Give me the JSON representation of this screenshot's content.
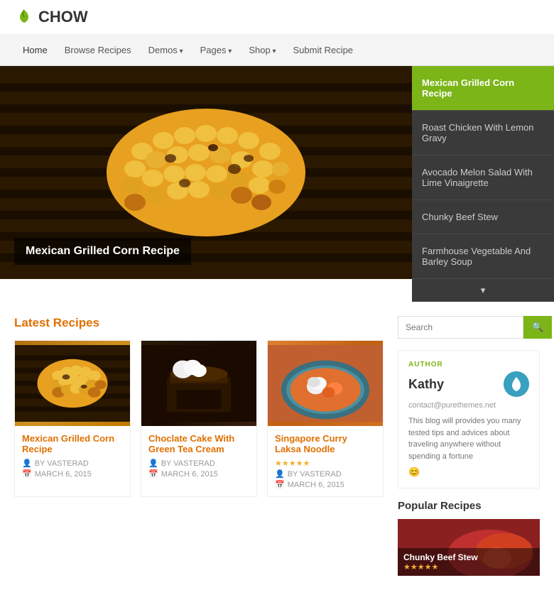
{
  "header": {
    "logo_text": "CHOW",
    "logo_icon": "🌿"
  },
  "nav": {
    "items": [
      {
        "label": "Home",
        "active": true,
        "has_arrow": false
      },
      {
        "label": "Browse Recipes",
        "active": false,
        "has_arrow": false
      },
      {
        "label": "Demos",
        "active": false,
        "has_arrow": true
      },
      {
        "label": "Pages",
        "active": false,
        "has_arrow": true
      },
      {
        "label": "Shop",
        "active": false,
        "has_arrow": true
      },
      {
        "label": "Submit Recipe",
        "active": false,
        "has_arrow": false
      }
    ]
  },
  "hero": {
    "caption": "Mexican Grilled Corn Recipe",
    "sidebar_items": [
      {
        "label": "Mexican Grilled Corn Recipe",
        "active": true
      },
      {
        "label": "Roast Chicken With Lemon Gravy",
        "active": false
      },
      {
        "label": "Avocado Melon Salad With Lime Vinaigrette",
        "active": false
      },
      {
        "label": "Chunky Beef Stew",
        "active": false
      },
      {
        "label": "Farmhouse Vegetable And Barley Soup",
        "active": false
      }
    ]
  },
  "latest_recipes": {
    "section_title": "Latest Recipes",
    "recipes": [
      {
        "title": "Mexican Grilled Corn Recipe",
        "author": "BY VASTERAD",
        "date": "MARCH 6, 2015",
        "has_stars": false,
        "img_type": "corn"
      },
      {
        "title": "Choclate Cake With Green Tea Cream",
        "author": "BY VASTERAD",
        "date": "MARCH 6, 2015",
        "has_stars": false,
        "img_type": "cake"
      },
      {
        "title": "Singapore Curry Laksa Noodle",
        "author": "BY VASTERAD",
        "date": "MARCH 6, 2015",
        "has_stars": true,
        "stars": "★★★★★",
        "img_type": "curry"
      }
    ]
  },
  "sidebar": {
    "search_placeholder": "Search",
    "author": {
      "label": "AUTHOR",
      "name": "Kathy",
      "email": "contact@purethemes.net",
      "description": "This blog will provides you many tested tips and advices about traveling anywhere without spending a fortune",
      "emoji": "😊"
    },
    "popular": {
      "title": "Popular Recipes",
      "items": [
        {
          "title": "Chunky Beef Stew",
          "stars": "★★★★★"
        }
      ]
    }
  },
  "icons": {
    "search": "🔍",
    "calendar": "📅",
    "user": "👤",
    "drop": "💧"
  }
}
